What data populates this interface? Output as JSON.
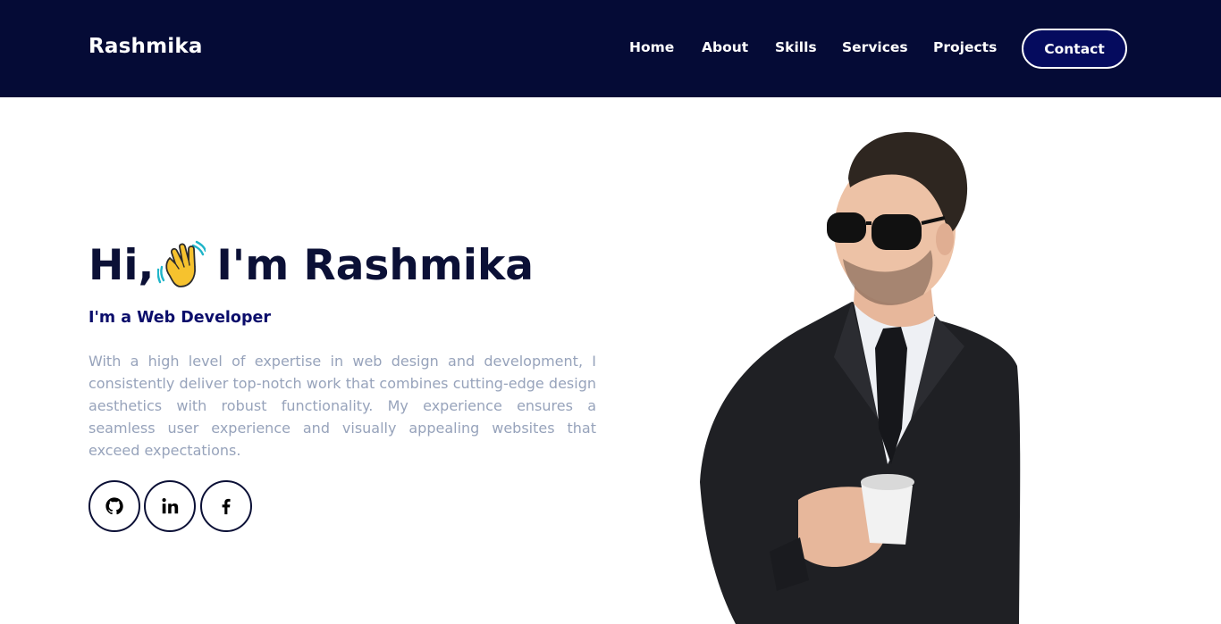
{
  "nav": {
    "brand": "Rashmika",
    "links": [
      "Home",
      "About",
      "Skills",
      "Services",
      "Projects"
    ],
    "contact": "Contact"
  },
  "hero": {
    "greeting": "Hi,",
    "name_line": "I'm Rashmika",
    "subtitle": "I'm a Web Developer",
    "description": "With a high level of expertise in web design and development, I consistently deliver top-notch work that combines cutting-edge design aesthetics with robust functionality. My experience ensures a seamless user experience and visually appealing websites that exceed expectations.",
    "wave_icon": "waving-hand-icon",
    "portrait": "man-in-suit-with-sunglasses-holding-coffee-cup"
  },
  "socials": [
    "github-icon",
    "linkedin-icon",
    "facebook-icon"
  ],
  "colors": {
    "navbar_bg": "#050b36",
    "heading": "#0b1036",
    "subtitle": "#0b0d6b",
    "body_text": "#97a3bb",
    "contact_bg": "#050b5e"
  }
}
